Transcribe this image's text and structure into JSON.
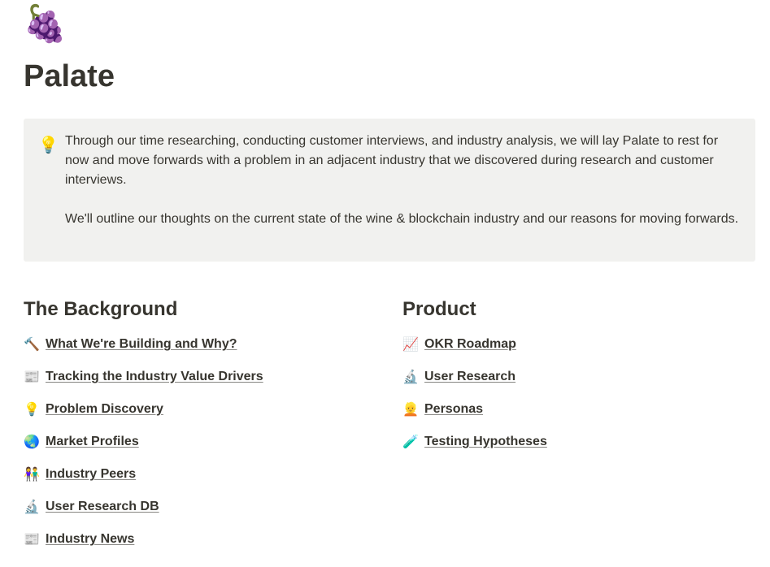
{
  "page": {
    "icon": "🍇",
    "icon_name": "grapes-icon",
    "title": "Palate"
  },
  "callout": {
    "icon": "💡",
    "icon_name": "lightbulb-icon",
    "background": "#f1f1ef",
    "paragraphs": [
      "Through our time researching, conducting customer interviews, and industry analysis, we will lay Palate to rest for now and move forwards with a problem in an adjacent industry that we discovered during research and customer interviews.",
      "We'll outline our thoughts on the current state of the wine & blockchain industry and our reasons for moving forwards."
    ]
  },
  "background_section": {
    "heading": "The Background",
    "links": [
      {
        "icon": "🔨",
        "icon_name": "hammer-icon",
        "label": "What We're Building and Why?"
      },
      {
        "icon": "📰",
        "icon_name": "newspaper-icon",
        "label": "Tracking the Industry Value Drivers"
      },
      {
        "icon": "💡",
        "icon_name": "lightbulb-icon",
        "label": "Problem Discovery"
      },
      {
        "icon": "🌏",
        "icon_name": "globe-icon",
        "label": "Market Profiles"
      },
      {
        "icon": "👫",
        "icon_name": "people-icon",
        "label": "Industry Peers"
      },
      {
        "icon": "🔬",
        "icon_name": "microscope-icon",
        "label": "User Research DB"
      },
      {
        "icon": "📰",
        "icon_name": "newspaper-icon",
        "label": "Industry News"
      }
    ]
  },
  "product_section": {
    "heading": "Product",
    "links": [
      {
        "icon": "📈",
        "icon_name": "chart-increasing-icon",
        "label": "OKR Roadmap"
      },
      {
        "icon": "🔬",
        "icon_name": "microscope-icon",
        "label": "User Research"
      },
      {
        "icon": "👱",
        "icon_name": "person-icon",
        "label": "Personas"
      },
      {
        "icon": "🧪",
        "icon_name": "test-tube-icon",
        "label": "Testing Hypotheses"
      }
    ]
  }
}
